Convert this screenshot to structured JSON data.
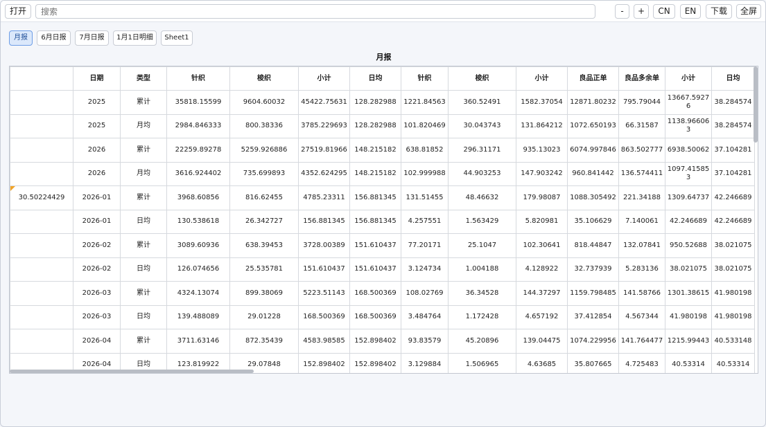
{
  "toolbar": {
    "open": "打开",
    "search_placeholder": "搜索",
    "zoom_out": "-",
    "zoom_in": "+",
    "lang_cn": "CN",
    "lang_en": "EN",
    "download": "下载",
    "fullscreen": "全屏"
  },
  "tabs": [
    "月报",
    "6月日报",
    "7月日报",
    "1月1日明细",
    "Sheet1"
  ],
  "sheet_title": "月报",
  "columns": [
    "",
    "日期",
    "类型",
    "针织",
    "梭织",
    "小计",
    "日均",
    "针织",
    "梭织",
    "小计",
    "良品正单",
    "良品多余单",
    "小计",
    "日均"
  ],
  "rows": [
    [
      "",
      "2025",
      "累计",
      "35818.15599",
      "9604.60032",
      "45422.75631",
      "128.282988",
      "1221.84563",
      "360.52491",
      "1582.37054",
      "12871.80232",
      "795.79044",
      "13667.59276",
      "38.284574"
    ],
    [
      "",
      "2025",
      "月均",
      "2984.846333",
      "800.38336",
      "3785.229693",
      "128.282988",
      "101.820469",
      "30.043743",
      "131.864212",
      "1072.650193",
      "66.31587",
      "1138.966063",
      "38.284574"
    ],
    [
      "",
      "2026",
      "累计",
      "22259.89278",
      "5259.926886",
      "27519.81966",
      "148.215182",
      "638.81852",
      "296.31171",
      "935.13023",
      "6074.997846",
      "863.502777",
      "6938.50062",
      "37.104281"
    ],
    [
      "",
      "2026",
      "月均",
      "3616.924402",
      "735.699893",
      "4352.624295",
      "148.215182",
      "102.999988",
      "44.903253",
      "147.903242",
      "960.841442",
      "136.574411",
      "1097.415853",
      "37.104281"
    ],
    [
      "30.50224429",
      "2026-01",
      "累计",
      "3968.60856",
      "816.62455",
      "4785.23311",
      "156.881345",
      "131.51455",
      "48.46632",
      "179.98087",
      "1088.305492",
      "221.34188",
      "1309.64737",
      "42.246689"
    ],
    [
      "",
      "2026-01",
      "日均",
      "130.538618",
      "26.342727",
      "156.881345",
      "156.881345",
      "4.257551",
      "1.563429",
      "5.820981",
      "35.106629",
      "7.140061",
      "42.246689",
      "42.246689"
    ],
    [
      "",
      "2026-02",
      "累计",
      "3089.60936",
      "638.39453",
      "3728.00389",
      "151.610437",
      "77.20171",
      "25.1047",
      "102.30641",
      "818.44847",
      "132.07841",
      "950.52688",
      "38.021075"
    ],
    [
      "",
      "2026-02",
      "日均",
      "126.074656",
      "25.535781",
      "151.610437",
      "151.610437",
      "3.124734",
      "1.004188",
      "4.128922",
      "32.737939",
      "5.283136",
      "38.021075",
      "38.021075"
    ],
    [
      "",
      "2026-03",
      "累计",
      "4324.13074",
      "899.38069",
      "5223.51143",
      "168.500369",
      "108.02769",
      "36.34528",
      "144.37297",
      "1159.798485",
      "141.58766",
      "1301.38615",
      "41.980198"
    ],
    [
      "",
      "2026-03",
      "日均",
      "139.488089",
      "29.01228",
      "168.500369",
      "168.500369",
      "3.484764",
      "1.172428",
      "4.657192",
      "37.412854",
      "4.567344",
      "41.980198",
      "41.980198"
    ],
    [
      "",
      "2026-04",
      "累计",
      "3711.63146",
      "872.35439",
      "4583.98585",
      "152.898402",
      "93.83579",
      "45.20896",
      "139.04475",
      "1074.229956",
      "141.764477",
      "1215.99443",
      "40.533148"
    ],
    [
      "",
      "2026-04",
      "日均",
      "123.819922",
      "29.07848",
      "152.898402",
      "152.898402",
      "3.129884",
      "1.506965",
      "4.63685",
      "35.807665",
      "4.725483",
      "40.53314",
      "40.53314"
    ]
  ],
  "colors": {
    "active_tab_bg": "#dbe8fb",
    "active_tab_border": "#6d9de6",
    "flag": "#f2a428"
  }
}
